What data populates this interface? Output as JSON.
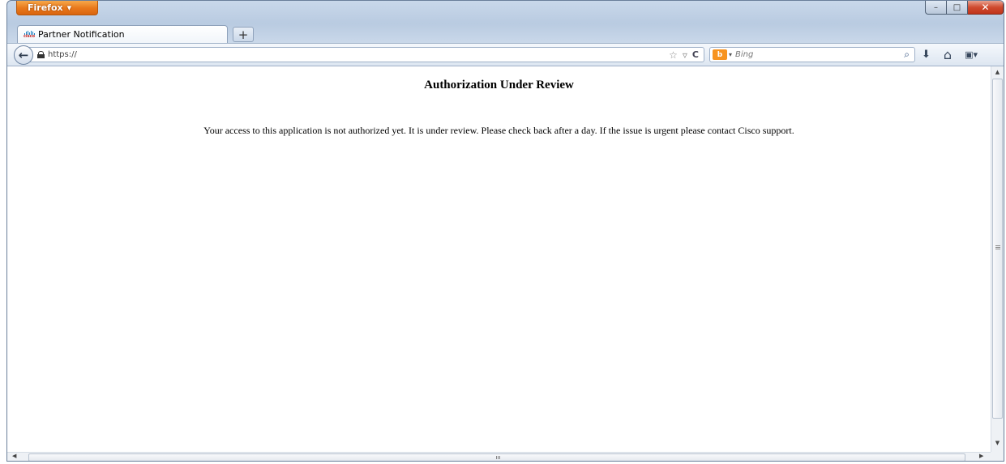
{
  "browser": {
    "menu_button_label": "Firefox",
    "menu_button_arrow": "▾",
    "caption_buttons": {
      "minimize": "–",
      "maximize": "□",
      "close": "✕"
    },
    "new_tab_label": "+"
  },
  "tab": {
    "title": "Partner Notification",
    "favicon": "cisco-logo-icon",
    "favicon_text": "cisco"
  },
  "navbar": {
    "back_icon": "←",
    "url": "https://",
    "bookmark_star_icon": "☆",
    "history_dropdown_icon": "▿",
    "reload_icon": "C",
    "search_engine_placeholder": "Bing",
    "search_engine_logo_text": "b",
    "search_button_icon": "⌕",
    "download_icon": "⬇",
    "home_icon": "⌂",
    "bookmarks_menu_icon": "▣▾"
  },
  "page": {
    "heading": "Authorization Under Review",
    "message": "Your access to this application is not authorized yet. It is under review. Please check back after a day. If the issue is urgent please contact Cisco support."
  },
  "scrollbars": {
    "up_arrow": "▲",
    "down_arrow": "▼",
    "left_arrow": "◀",
    "right_arrow": "▶"
  },
  "colors": {
    "firefox_button": "#e8771a",
    "close_button": "#c0341a",
    "window_frame": "#c9d8ea"
  }
}
